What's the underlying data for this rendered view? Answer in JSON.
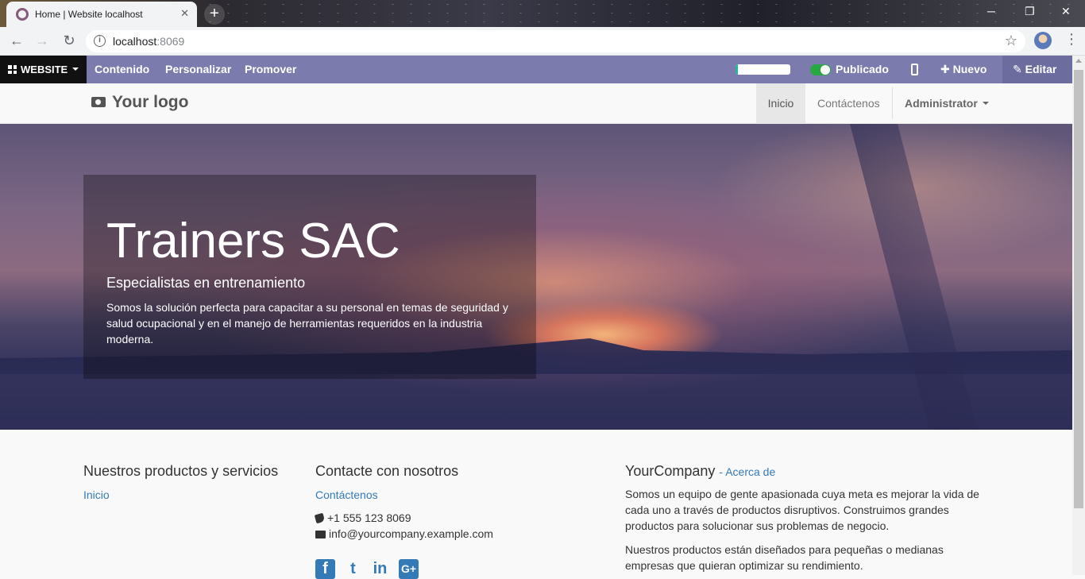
{
  "browser": {
    "tab_title": "Home | Website localhost",
    "tab_close": "✕",
    "new_tab": "+",
    "url_host": "localhost",
    "url_port": ":8069",
    "win_minimize": "─",
    "win_restore": "❐",
    "win_close": "✕"
  },
  "adminbar": {
    "website_menu": "WEBSITE",
    "menus": [
      "Contenido",
      "Personalizar",
      "Promover"
    ],
    "progress_fraction": 0.05,
    "published_label": "Publicado",
    "new_label": "Nuevo",
    "edit_label": "Editar",
    "accent_color": "#7c7bad"
  },
  "site_header": {
    "logo_text": "Your logo",
    "nav": [
      "Inicio",
      "Contáctenos"
    ],
    "user_menu": "Administrator"
  },
  "hero": {
    "title": "Trainers SAC",
    "subtitle": "Especialistas en entrenamiento",
    "text": "Somos la solución perfecta para capacitar a su personal en temas de seguridad y salud ocupacional y en el manejo de herramientas requeridos en la industria moderna."
  },
  "footer": {
    "col1": {
      "title": "Nuestros productos y servicios",
      "links": [
        "Inicio"
      ]
    },
    "col2": {
      "title": "Contacte con nosotros",
      "link": "Contáctenos",
      "phone": "+1 555 123 8069",
      "email": "info@yourcompany.example.com",
      "social": [
        "f",
        "t",
        "in",
        "G+"
      ]
    },
    "col3": {
      "title": "YourCompany",
      "about_link": "- Acerca de",
      "para1": "Somos un equipo de gente apasionada cuya meta es mejorar la vida de cada uno a través de productos disruptivos. Construimos grandes productos para solucionar sus problemas de negocio.",
      "para2": "Nuestros productos están diseñados para pequeñas o medianas empresas que quieran optimizar su rendimiento."
    },
    "link_color": "#337ab7"
  }
}
